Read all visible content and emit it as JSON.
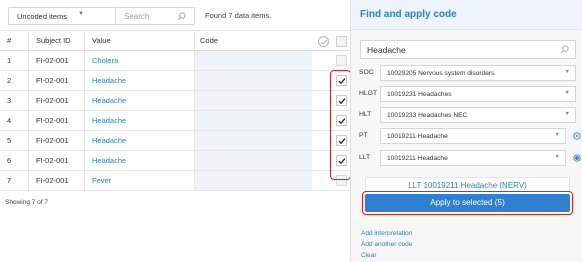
{
  "toolbar": {
    "filter_select": "Uncoded items",
    "search_placeholder": "Search",
    "found_text": "Found 7 data items."
  },
  "table": {
    "headers": {
      "num": "#",
      "subject": "Subject ID",
      "value": "Value",
      "code": "Code"
    },
    "rows": [
      {
        "num": "1",
        "subject": "FI-02-001",
        "value": "Cholera",
        "checked": false
      },
      {
        "num": "2",
        "subject": "FI-02-001",
        "value": "Headache",
        "checked": true
      },
      {
        "num": "3",
        "subject": "FI-02-001",
        "value": "Headache",
        "checked": true
      },
      {
        "num": "4",
        "subject": "FI-02-001",
        "value": "Headache",
        "checked": true
      },
      {
        "num": "5",
        "subject": "FI-02-001",
        "value": "Headache",
        "checked": true
      },
      {
        "num": "6",
        "subject": "FI-02-001",
        "value": "Headache",
        "checked": true
      },
      {
        "num": "7",
        "subject": "FI-02-001",
        "value": "Fever",
        "checked": false
      }
    ],
    "showing": "Showing 7 of 7"
  },
  "panel": {
    "title": "Find and apply code",
    "search_value": "Headache",
    "levels": [
      {
        "label": "SOC",
        "value": "10029205 Nervous system disorders"
      },
      {
        "label": "HLGT",
        "value": "10019231 Headaches"
      },
      {
        "label": "HLT",
        "value": "10019233 Headaches NEC"
      },
      {
        "label": "PT",
        "value": "10019211 Headache"
      },
      {
        "label": "LLT",
        "value": "10019211 Headache"
      }
    ],
    "selected_code": "LLT 10019211 Headache (NERV)",
    "apply_button": "Apply to selected (5)",
    "links": [
      "Add interpretation",
      "Add another code",
      "Clear"
    ]
  },
  "colors": {
    "accent": "#2f80d1",
    "link": "#2f7fc8",
    "highlight": "#e02020",
    "code_cell": "#eef3fa"
  }
}
